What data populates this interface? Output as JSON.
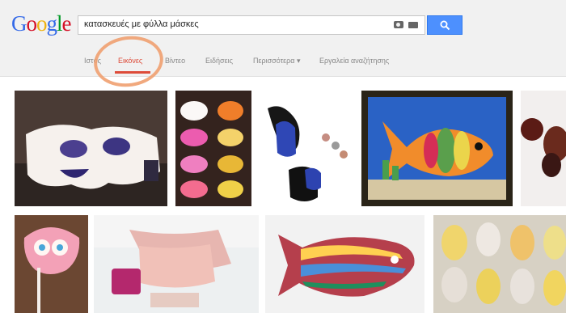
{
  "logo": {
    "letters": [
      "G",
      "o",
      "o",
      "g",
      "l",
      "e"
    ],
    "colors": [
      "#3369e8",
      "#d50f25",
      "#eeb211",
      "#3369e8",
      "#009925",
      "#d50f25"
    ]
  },
  "search": {
    "query": "κατασκευές με φύλλα μάσκες",
    "camera_icon": "camera-icon",
    "keyboard_icon": "keyboard-icon",
    "button_icon": "magnifier-icon"
  },
  "tabs": [
    {
      "label": "Ιστός",
      "active": false
    },
    {
      "label": "Εικόνες",
      "active": true
    },
    {
      "label": "Βίντεο",
      "active": false
    },
    {
      "label": "Ειδήσεις",
      "active": false
    },
    {
      "label": "Περισσότερα ▾",
      "active": false
    },
    {
      "label": "Εργαλεία αναζήτησης",
      "active": false
    }
  ],
  "colors": {
    "header_bg": "#f1f1f1",
    "accent_blue": "#4d90fe",
    "active_tab_red": "#dd4b39",
    "annotation_circle": "#f0a070"
  }
}
